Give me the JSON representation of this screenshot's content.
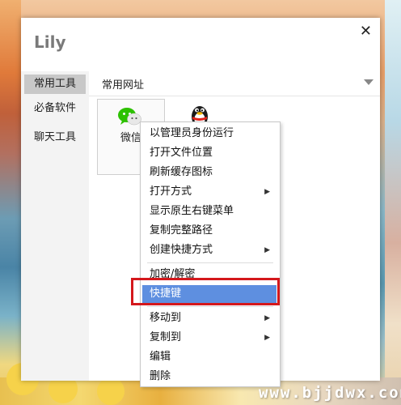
{
  "window": {
    "title": "Lily",
    "close_glyph": "✕"
  },
  "sidebar": {
    "items": [
      {
        "label": "常用工具"
      },
      {
        "label": "必备软件"
      },
      {
        "label": "聊天工具"
      }
    ]
  },
  "main": {
    "header_label": "常用网址",
    "tiles": [
      {
        "label": "微信",
        "icon": "wechat-icon"
      },
      {
        "label": "",
        "icon": "qq-penguin-icon"
      }
    ]
  },
  "context_menu": {
    "items": [
      {
        "label": "以管理员身份运行"
      },
      {
        "label": "打开文件位置"
      },
      {
        "label": "刷新缓存图标"
      },
      {
        "label": "打开方式"
      },
      {
        "label": "显示原生右键菜单"
      },
      {
        "label": "复制完整路径"
      },
      {
        "label": "创建快捷方式"
      },
      {
        "label": "加密/解密"
      },
      {
        "label": "快捷键"
      },
      {
        "label": "移动到"
      },
      {
        "label": "复制到"
      },
      {
        "label": "编辑"
      },
      {
        "label": "删除"
      }
    ],
    "submenu_arrow": "▶"
  },
  "watermark": "www.bjjdwx.com",
  "colors": {
    "highlight": "#5e8fe0",
    "annotation_red": "#d4181c"
  }
}
